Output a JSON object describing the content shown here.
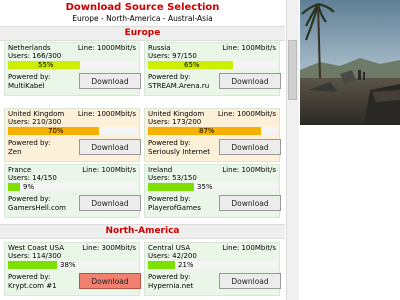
{
  "header": {
    "title": "Download Source Selection",
    "nav": {
      "europe": "Europe",
      "sep1": " - ",
      "north_america": "North-America",
      "sep2": " - ",
      "austral_asia": "Austral-Asia"
    }
  },
  "regions": [
    {
      "name": "Europe",
      "servers": [
        {
          "country": "Netherlands",
          "line": "Line: 1000Mbit/s",
          "users": "Users: 166/300",
          "percent": 55,
          "percent_label": "55%",
          "powered_by_label": "Powered by:",
          "provider": "MultiKabel",
          "download_label": "Download"
        },
        {
          "country": "Russia",
          "line": "Line: 100Mbit/s",
          "users": "Users: 97/150",
          "percent": 65,
          "percent_label": "65%",
          "powered_by_label": "Powered by:",
          "provider": "STREAM.Arena.ru",
          "download_label": "Download"
        },
        {
          "country": "United Kingdom",
          "line": "Line: 1000Mbit/s",
          "users": "Users: 210/300",
          "percent": 70,
          "percent_label": "70%",
          "powered_by_label": "Powered by:",
          "provider": "Zen",
          "download_label": "Download"
        },
        {
          "country": "United Kingdom",
          "line": "Line: 1000Mbit/s",
          "users": "Users: 173/200",
          "percent": 87,
          "percent_label": "87%",
          "powered_by_label": "Powered by:",
          "provider": "Seriously Internet",
          "download_label": "Download"
        },
        {
          "country": "France",
          "line": "Line: 100Mbit/s",
          "users": "Users: 14/150",
          "percent": 9,
          "percent_label": "9%",
          "powered_by_label": "Powered by:",
          "provider": "GamersHell.com",
          "download_label": "Download"
        },
        {
          "country": "Ireland",
          "line": "Line: 100Mbit/s",
          "users": "Users: 53/150",
          "percent": 35,
          "percent_label": "35%",
          "powered_by_label": "Powered by:",
          "provider": "PlayerofGames",
          "download_label": "Download"
        }
      ]
    },
    {
      "name": "North-America",
      "servers": [
        {
          "country": "West Coast USA",
          "line": "Line: 300Mbit/s",
          "users": "Users: 114/300",
          "percent": 38,
          "percent_label": "38%",
          "powered_by_label": "Powered by:",
          "provider": "Krypt.com #1",
          "download_label": "Download"
        },
        {
          "country": "Central USA",
          "line": "Line: 100Mbit/s",
          "users": "Users: 42/200",
          "percent": 21,
          "percent_label": "21%",
          "powered_by_label": "Powered by:",
          "provider": "Hypernia.net",
          "download_label": "Download"
        }
      ]
    }
  ],
  "colors": {
    "title_red": "#cc0000",
    "card_green_bg": "#eaf7e8",
    "card_orange_bg": "#fdf0d8",
    "card_border": "#d8e8d4",
    "bar_green": "#7ee000",
    "bar_yellowgreen": "#ccee00",
    "bar_orange": "#f5b000",
    "bar_track": "#f4f4f4",
    "button_highlight": "#f08070"
  }
}
